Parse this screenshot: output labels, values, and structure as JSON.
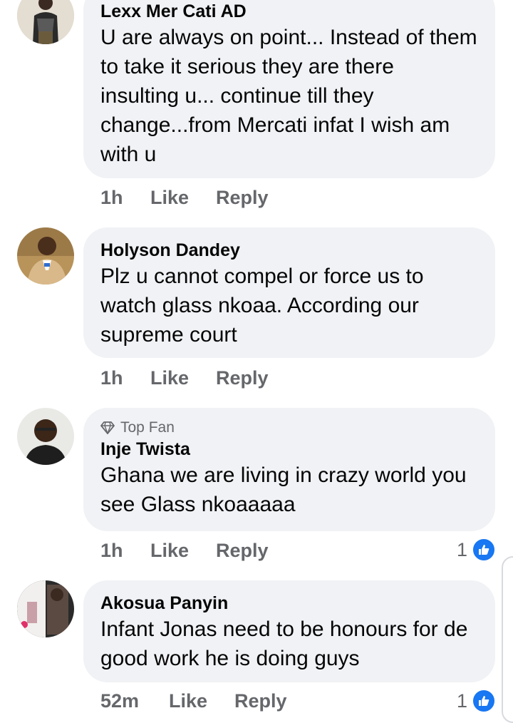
{
  "comments": [
    {
      "name": "Lexx Mer Cati AD",
      "top_fan_label": "",
      "text": "U are always on  point... Instead of them to take it serious they are there insulting u... continue till they change...from Mercati infat I wish am with u",
      "time": "1h",
      "like": "Like",
      "reply": "Reply",
      "reaction_count": ""
    },
    {
      "name": "Holyson Dandey",
      "top_fan_label": "",
      "text": "Plz u cannot compel or force us to watch glass nkoaa. According our supreme court",
      "time": "1h",
      "like": "Like",
      "reply": "Reply",
      "reaction_count": ""
    },
    {
      "name": "Inje Twista",
      "top_fan_label": "Top Fan",
      "text": "Ghana we are living in crazy world you see Glass nkoaaaaa",
      "time": "1h",
      "like": "Like",
      "reply": "Reply",
      "reaction_count": "1"
    },
    {
      "name": "Akosua Panyin",
      "top_fan_label": "",
      "text": "Infant Jonas need to be honours for de good work he is doing guys",
      "time": "52m",
      "like": "Like",
      "reply": "Reply",
      "reaction_count": "1"
    }
  ],
  "icons": {
    "reaction": "like-thumb-icon",
    "badge": "diamond-icon"
  },
  "colors": {
    "bubble": "#f0f2f5",
    "meta": "#65676b",
    "like_blue": "#1877f2"
  }
}
